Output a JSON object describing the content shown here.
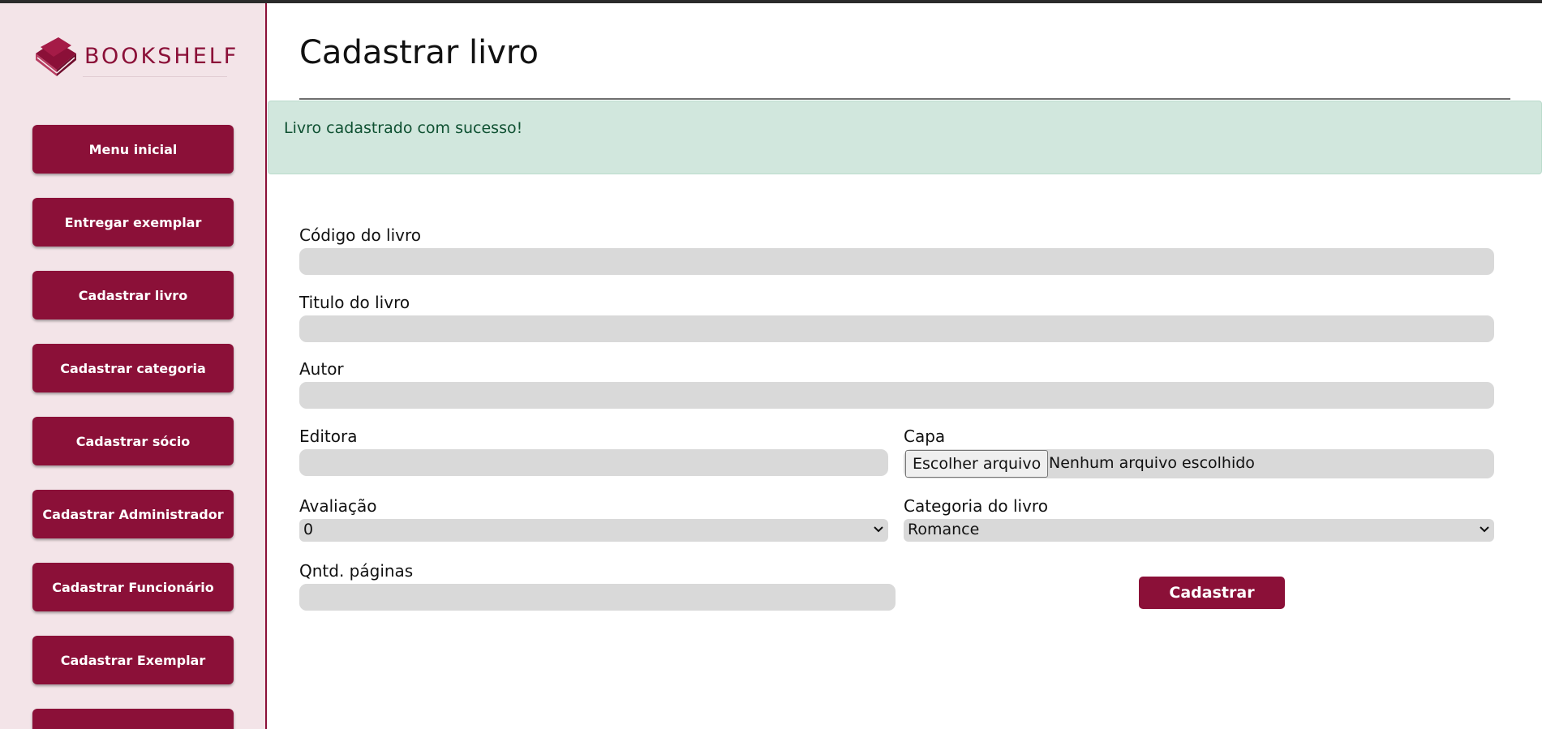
{
  "brand": {
    "name": "BOOKSHELF",
    "color": "#8b1038"
  },
  "sidebar": {
    "items": [
      {
        "label": "Menu inicial"
      },
      {
        "label": "Entregar exemplar"
      },
      {
        "label": "Cadastrar livro"
      },
      {
        "label": "Cadastrar categoria"
      },
      {
        "label": "Cadastrar sócio"
      },
      {
        "label": "Cadastrar Administrador"
      },
      {
        "label": "Cadastrar Funcionário"
      },
      {
        "label": "Cadastrar Exemplar"
      },
      {
        "label": ""
      }
    ]
  },
  "main": {
    "title": "Cadastrar livro",
    "alert": {
      "message": "Livro cadastrado com sucesso!"
    },
    "form": {
      "codigo": {
        "label": "Código do livro",
        "value": ""
      },
      "titulo": {
        "label": "Titulo do livro",
        "value": ""
      },
      "autor": {
        "label": "Autor",
        "value": ""
      },
      "editora": {
        "label": "Editora",
        "value": ""
      },
      "capa": {
        "label": "Capa",
        "button_label": "Escolher arquivo",
        "status": "Nenhum arquivo escolhido"
      },
      "avaliacao": {
        "label": "Avaliação",
        "selected": "0"
      },
      "categoria": {
        "label": "Categoria do livro",
        "selected": "Romance"
      },
      "paginas": {
        "label": "Qntd. páginas",
        "value": ""
      },
      "submit_label": "Cadastrar"
    }
  },
  "colors": {
    "sidebar_bg": "#f3e4e8",
    "accent": "#8b1038",
    "alert_bg": "#d1e7dd",
    "alert_text": "#0f5132",
    "input_bg": "#d9d9d9"
  }
}
